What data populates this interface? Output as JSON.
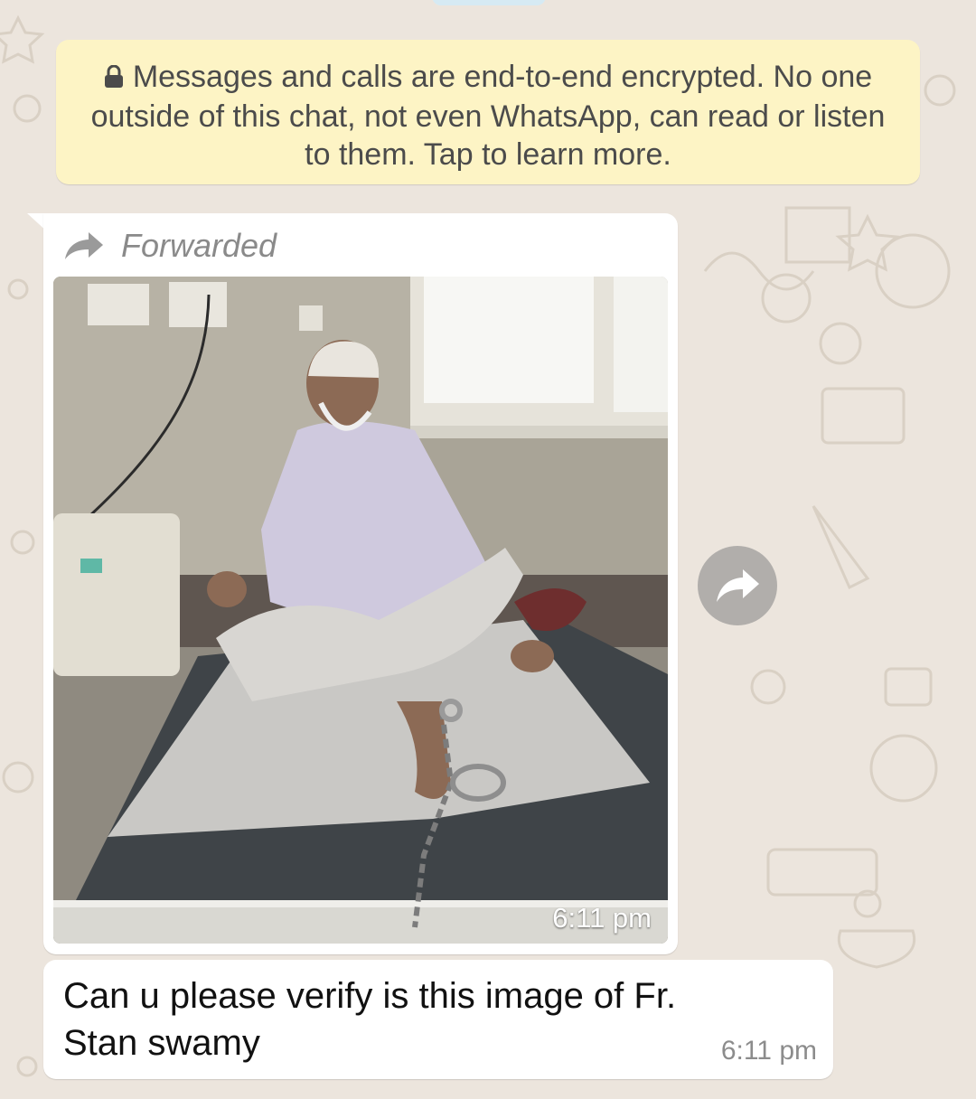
{
  "encryption_notice": {
    "text": "Messages and calls are end-to-end encrypted. No one outside of this chat, not even WhatsApp, can read or listen to them. Tap to learn more.",
    "icon": "lock-icon"
  },
  "messages": [
    {
      "type": "image",
      "forwarded_label": "Forwarded",
      "forward_icon": "forward-arrow-icon",
      "time": "6:11 pm",
      "image_description_icon": "photo-elderly-man-hospital-bed"
    },
    {
      "type": "text",
      "text": "Can u please verify is this image of Fr. Stan swamy",
      "time": "6:11 pm"
    }
  ],
  "share_button": {
    "icon": "share-forward-icon"
  },
  "colors": {
    "wallpaper": "#ECE5DD",
    "encryption_banner": "#FDF4C5",
    "bubble": "#FFFFFF",
    "meta_text": "#8C8C8C"
  }
}
